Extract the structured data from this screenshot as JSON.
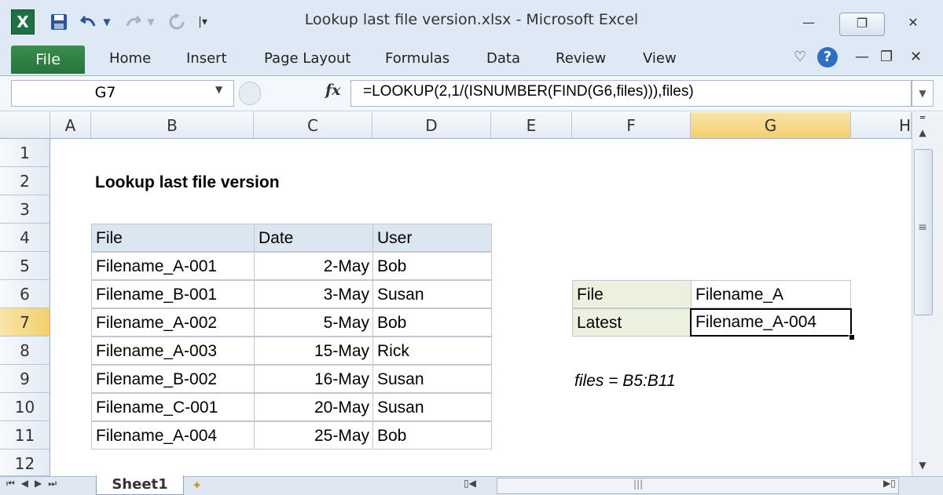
{
  "window": {
    "title": "Lookup last file version.xlsx  -  Microsoft Excel",
    "app_logo": "X",
    "min_label": "—",
    "restore_label": "❐",
    "close_label": "✕"
  },
  "quick_access": {
    "save_icon": "save-icon",
    "undo_icon": "undo-icon",
    "redo_icon": "redo-icon",
    "repeat_icon": "repeat-icon",
    "customize_icon": "customize-icon"
  },
  "ribbon": {
    "tabs": [
      "File",
      "Home",
      "Insert",
      "Page Layout",
      "Formulas",
      "Data",
      "Review",
      "View"
    ]
  },
  "formula_bar": {
    "name_box": "G7",
    "fx_label": "fx",
    "formula": "=LOOKUP(2,1/(ISNUMBER(FIND(G6,files))),files)"
  },
  "grid": {
    "columns": [
      "A",
      "B",
      "C",
      "D",
      "E",
      "F",
      "G",
      "H"
    ],
    "selected_column": "G",
    "rows": [
      "1",
      "2",
      "3",
      "4",
      "5",
      "6",
      "7",
      "8",
      "9",
      "10",
      "11",
      "12"
    ],
    "selected_row": "7"
  },
  "sheet": {
    "title": "Lookup last file version",
    "table_headers": [
      "File",
      "Date",
      "User"
    ],
    "table_rows": [
      [
        "Filename_A-001",
        "2-May",
        "Bob"
      ],
      [
        "Filename_B-001",
        "3-May",
        "Susan"
      ],
      [
        "Filename_A-002",
        "5-May",
        "Bob"
      ],
      [
        "Filename_A-003",
        "15-May",
        "Rick"
      ],
      [
        "Filename_B-002",
        "16-May",
        "Susan"
      ],
      [
        "Filename_C-001",
        "20-May",
        "Susan"
      ],
      [
        "Filename_A-004",
        "25-May",
        "Bob"
      ]
    ],
    "lookup": {
      "file_label": "File",
      "file_value": "Filename_A",
      "latest_label": "Latest",
      "latest_value": "Filename_A-004"
    },
    "note": "files = B5:B11"
  },
  "sheet_tabs": {
    "active": "Sheet1"
  },
  "colors": {
    "header_fill": "#dce6f1",
    "label_fill": "#ebf1de",
    "selection_header": "#f4cf6e",
    "file_tab": "#24753a"
  }
}
